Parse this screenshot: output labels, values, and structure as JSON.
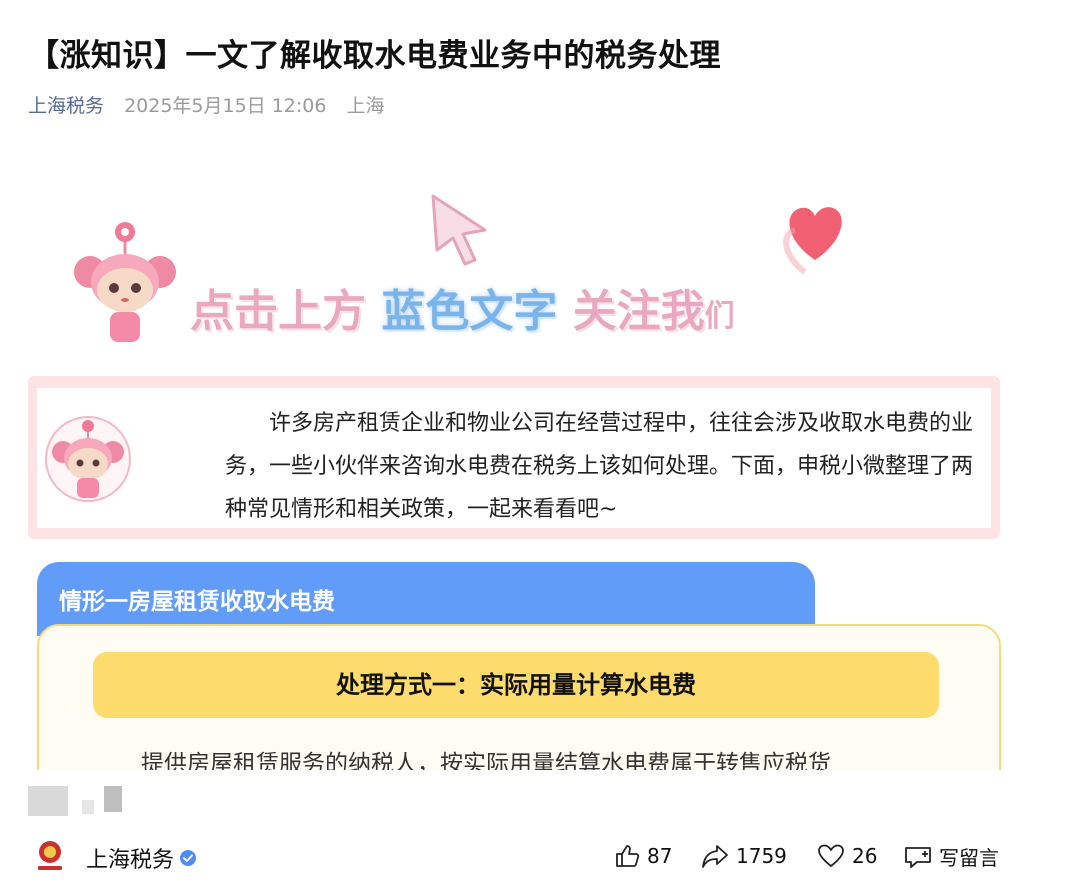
{
  "article": {
    "title": "【涨知识】一文了解收取水电费业务中的税务处理",
    "author": "上海税务",
    "date": "2025年5月15日 12:06",
    "location": "上海"
  },
  "banner": {
    "part1": "点击上方",
    "part2": "蓝色文字",
    "part3": "关注我",
    "part4": "们"
  },
  "intro": {
    "text": "许多房产租赁企业和物业公司在经营过程中，往往会涉及收取水电费的业务，一些小伙伴来咨询水电费在税务上该如何处理。下面，申税小微整理了两种常见情形和相关政策，一起来看看吧~"
  },
  "section": {
    "heading": "情形一房屋租赁收取水电费",
    "method_title": "处理方式一：实际用量计算水电费",
    "body_line": "提供房屋租赁服务的纳税人，按实际用量结算水电费属于转售应税货"
  },
  "footer": {
    "account_name": "上海税务",
    "likes": "87",
    "shares": "1759",
    "favorites": "26",
    "comment_label": "写留言"
  },
  "colors": {
    "accent_blue": "#619cf9",
    "pill_yellow": "#fddb6c",
    "intro_pink": "#fde3e4",
    "meta_link": "#576b95"
  }
}
